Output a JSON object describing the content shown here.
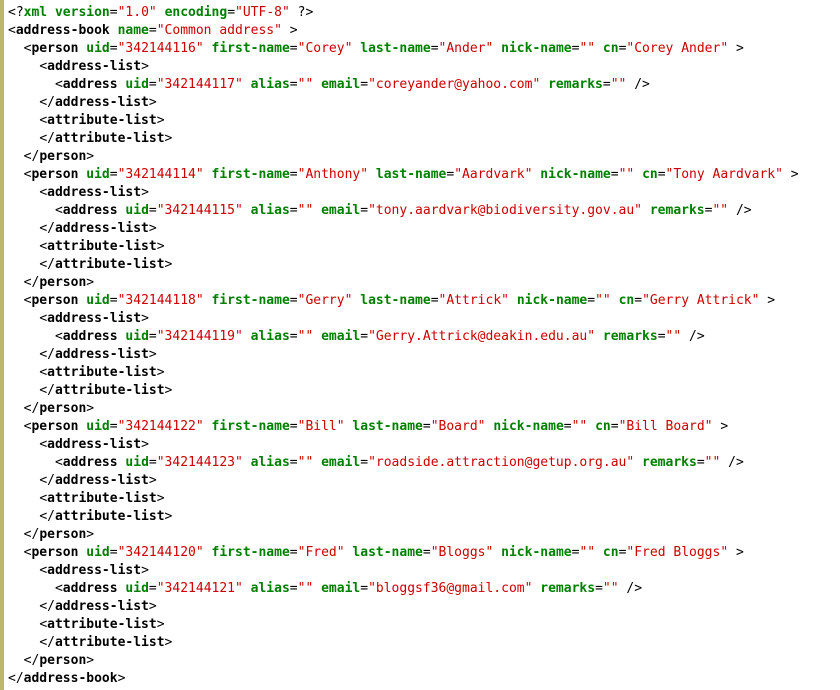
{
  "xml_decl": {
    "version": "1.0",
    "encoding": "UTF-8"
  },
  "root": {
    "name": "Common address"
  },
  "persons": [
    {
      "uid": "342144116",
      "first_name": "Corey",
      "last_name": "Ander",
      "nick_name": "",
      "cn": "Corey Ander",
      "addresses": [
        {
          "uid": "342144117",
          "alias": "",
          "email": "coreyander@yahoo.com",
          "remarks": ""
        }
      ]
    },
    {
      "uid": "342144114",
      "first_name": "Anthony",
      "last_name": "Aardvark",
      "nick_name": "",
      "cn": "Tony Aardvark",
      "addresses": [
        {
          "uid": "342144115",
          "alias": "",
          "email": "tony.aardvark@biodiversity.gov.au",
          "remarks": ""
        }
      ]
    },
    {
      "uid": "342144118",
      "first_name": "Gerry",
      "last_name": "Attrick",
      "nick_name": "",
      "cn": "Gerry Attrick",
      "addresses": [
        {
          "uid": "342144119",
          "alias": "",
          "email": "Gerry.Attrick@deakin.edu.au",
          "remarks": ""
        }
      ]
    },
    {
      "uid": "342144122",
      "first_name": "Bill",
      "last_name": "Board",
      "nick_name": "",
      "cn": "Bill Board",
      "addresses": [
        {
          "uid": "342144123",
          "alias": "",
          "email": "roadside.attraction@getup.org.au",
          "remarks": ""
        }
      ]
    },
    {
      "uid": "342144120",
      "first_name": "Fred",
      "last_name": "Bloggs",
      "nick_name": "",
      "cn": "Fred Bloggs",
      "addresses": [
        {
          "uid": "342144121",
          "alias": "",
          "email": "bloggsf36@gmail.com",
          "remarks": ""
        }
      ]
    }
  ]
}
